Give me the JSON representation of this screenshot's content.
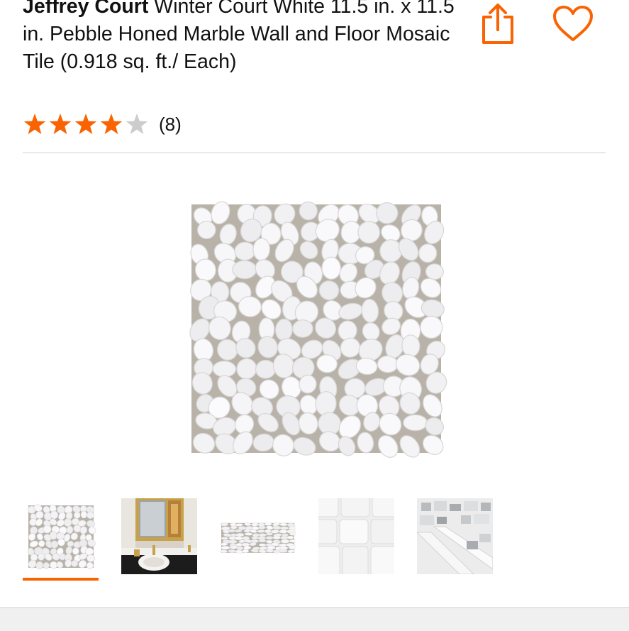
{
  "product": {
    "brand": "Jeffrey Court",
    "name": " Winter Court White 11.5 in. x 11.5 in. Pebble Honed Marble Wall and Floor Mosaic Tile (0.918 sq. ft./ Each)"
  },
  "rating": {
    "stars": 4,
    "max_stars": 5,
    "review_count_label": "(8)"
  },
  "actions": {
    "share_icon": "share-icon",
    "favorite_icon": "heart-icon"
  },
  "gallery": {
    "selected_index": 0,
    "thumbnails": [
      {
        "icon": "pebble-tile-thumbnail"
      },
      {
        "icon": "bathroom-scene-thumbnail"
      },
      {
        "icon": "pebble-tile-angle-thumbnail"
      },
      {
        "icon": "tile-closeup-thumbnail"
      },
      {
        "icon": "tile-detail-thumbnail"
      }
    ]
  },
  "colors": {
    "accent": "#f96302",
    "star_filled": "#f96302",
    "star_empty": "#cccccc",
    "text": "#111111"
  }
}
